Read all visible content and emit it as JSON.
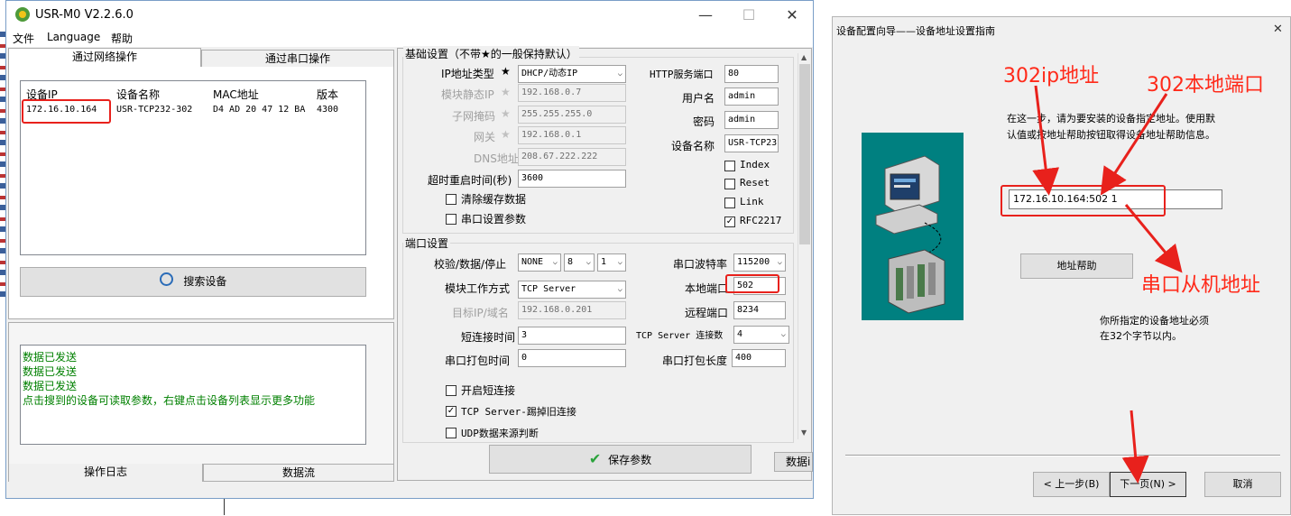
{
  "app": {
    "title": "USR-M0 V2.2.6.0",
    "minimize": "—",
    "maximize": "☐",
    "close": "✕"
  },
  "menu": [
    "文件",
    "Language",
    "帮助"
  ],
  "left_tabs": [
    "通过网络操作",
    "通过串口操作"
  ],
  "device_table": {
    "headers": [
      "设备IP",
      "设备名称",
      "MAC地址",
      "版本"
    ],
    "rows": [
      [
        "172.16.10.164",
        "USR-TCP232-302",
        "D4 AD 20 47 12 BA",
        "4300"
      ]
    ]
  },
  "search_button": "搜索设备",
  "log": [
    "数据已发送",
    "数据已发送",
    "数据已发送",
    "点击搜到的设备可读取参数，右键点击设备列表显示更多功能"
  ],
  "bottom_tabs": [
    "操作日志",
    "数据流"
  ],
  "basic": {
    "title": "基础设置（不带★的一般保持默认）",
    "ip_type_label": "IP地址类型",
    "ip_type": "DHCP/动态IP",
    "static_ip_label": "模块静态IP",
    "static_ip": "192.168.0.7",
    "mask_label": "子网掩码",
    "mask": "255.255.255.0",
    "gateway_label": "网关",
    "gateway": "192.168.0.1",
    "dns_label": "DNS地址",
    "dns": "208.67.222.222",
    "timeout_label": "超时重启时间(秒)",
    "timeout": "3600",
    "clear_cache": "清除缓存数据",
    "serial_params": "串口设置参数",
    "http_port_label": "HTTP服务端口",
    "http_port": "80",
    "user_label": "用户名",
    "user": "admin",
    "pass_label": "密码",
    "pass": "admin",
    "devname_label": "设备名称",
    "devname": "USR-TCP23",
    "checks": [
      "Index",
      "Reset",
      "Link",
      "RFC2217"
    ],
    "star": "★"
  },
  "port": {
    "title": "端口设置",
    "parity_label": "校验/数据/停止",
    "parity": "NONE",
    "databits": "8",
    "stopbits": "1",
    "baud_label": "串口波特率",
    "baud": "115200",
    "mode_label": "模块工作方式",
    "mode": "TCP Server",
    "local_port_label": "本地端口",
    "local_port": "502",
    "target_label": "目标IP/域名",
    "target": "192.168.0.201",
    "remote_port_label": "远程端口",
    "remote_port": "8234",
    "short_label": "短连接时间",
    "short": "3",
    "conn_label": "TCP Server 连接数",
    "conn": "4",
    "pack_time_label": "串口打包时间",
    "pack_time": "0",
    "pack_len_label": "串口打包长度",
    "pack_len": "400",
    "opt1": "开启短连接",
    "opt2": "TCP Server-踢掉旧连接",
    "opt3": "UDP数据来源判断"
  },
  "save_button": "保存参数",
  "data_tab": "数据i",
  "wizard": {
    "title": "设备配置向导——设备地址设置指南",
    "close": "✕",
    "desc1": "在这一步，请为要安装的设备指定地址。使用默",
    "desc2": "认值或按地址帮助按钮取得设备地址帮助信息。",
    "address": "172.16.10.164:502 1",
    "help_button": "地址帮助",
    "note1": "你所指定的设备地址必须",
    "note2": "在32个字节以内。",
    "prev": "< 上一步(B)",
    "next": "下一页(N) >",
    "cancel": "取消",
    "annot_ip": "302ip地址",
    "annot_port": "302本地端口",
    "annot_slave": "串口从机地址"
  },
  "colors": {
    "annotation": "#e8211c",
    "teal": "#008080",
    "log_green": "#008000"
  }
}
